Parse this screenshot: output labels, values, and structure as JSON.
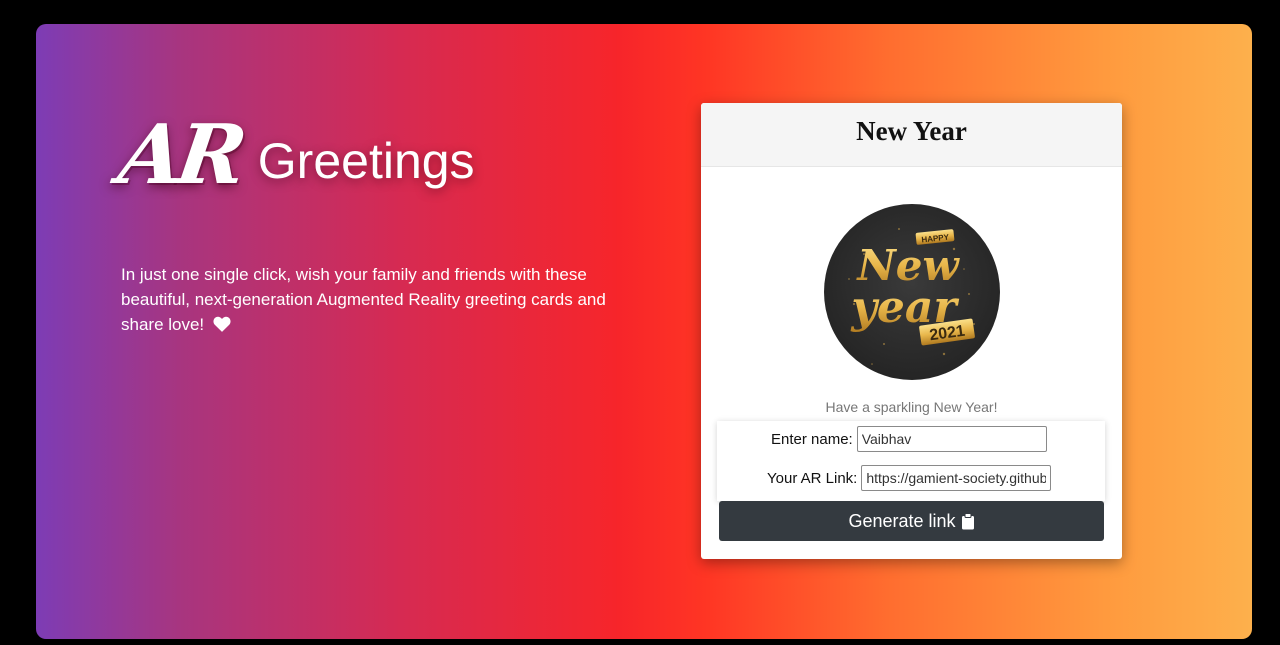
{
  "brand": {
    "ar": "AR",
    "name": "Greetings"
  },
  "tagline": "In just one single click, wish your family and friends with these beautiful, next-generation Augmented Reality greeting cards and share love!",
  "card": {
    "title": "New Year",
    "badge": {
      "top": "HAPPY",
      "line1": "New",
      "line2": "year",
      "year": "2021"
    },
    "message": "Have a sparkling New Year!",
    "name_label": "Enter name:",
    "name_value": "Vaibhav",
    "link_label": "Your AR Link:",
    "link_value": "https://gamient-society.github.io",
    "button_label": "Generate link"
  },
  "colors": {
    "gradient": [
      "#7d3cb5",
      "#d62a52",
      "#f7252a",
      "#ff6d2f",
      "#fdb04c"
    ],
    "button": "#343a40",
    "gold": "#e8b64a"
  },
  "icons": [
    "heart-icon",
    "clipboard-icon"
  ]
}
